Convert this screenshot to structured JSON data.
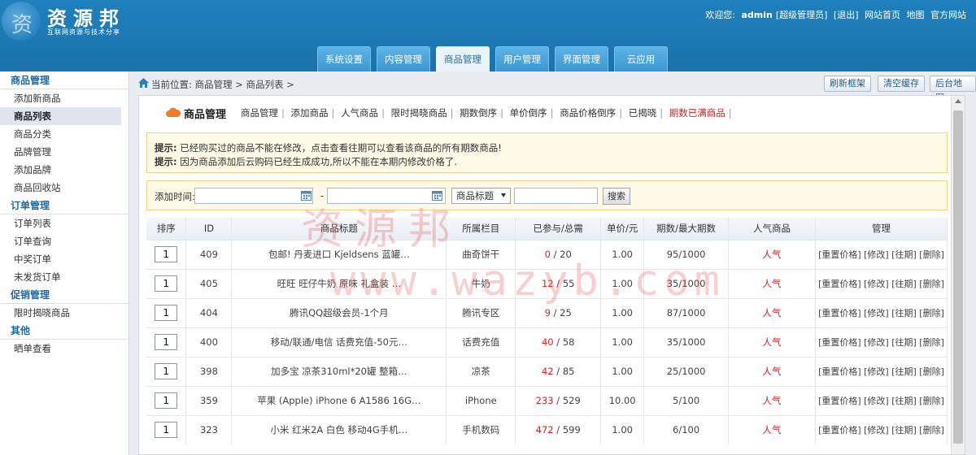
{
  "brand": {
    "logo_glyph": "资",
    "title": "资源邦",
    "subtitle": "互联网资源与技术分享"
  },
  "topbar": {
    "welcome": "欢迎您:",
    "username": "admin",
    "role": "[超级管理员]",
    "logout": "[退出]",
    "site_home": "网站首页",
    "map": "地图",
    "official": "官方网站"
  },
  "nav": {
    "tabs": [
      {
        "label": "系统设置"
      },
      {
        "label": "内容管理"
      },
      {
        "label": "商品管理",
        "active": true
      },
      {
        "label": "用户管理"
      },
      {
        "label": "界面管理"
      },
      {
        "label": "云应用"
      }
    ]
  },
  "sidebar": {
    "groups": [
      {
        "title": "商品管理",
        "items": [
          "添加新商品",
          "商品列表",
          "商品分类",
          "品牌管理",
          "添加品牌",
          "商品回收站"
        ]
      },
      {
        "title": "订单管理",
        "items": [
          "订单列表",
          "订单查询",
          "中奖订单",
          "未发货订单"
        ]
      },
      {
        "title": "促销管理",
        "items": [
          "限时揭晓商品"
        ]
      },
      {
        "title": "其他",
        "items": [
          "晒单查看"
        ]
      }
    ],
    "active_item": "商品列表"
  },
  "crumb": {
    "text": "当前位置: 商品管理 > 商品列表 >",
    "buttons": [
      "刷新框架",
      "清空缓存",
      "后台地图"
    ]
  },
  "module": {
    "title": "商品管理",
    "links": [
      "商品管理",
      "添加商品",
      "人气商品",
      "限时揭晓商品",
      "期数倒序",
      "单价倒序",
      "商品价格倒序",
      "已揭晓"
    ],
    "highlight_link": "期数已满商品"
  },
  "notice": {
    "label1": "提示:",
    "line1": "已经购买过的商品不能在修改，点击查看往期可以查看该商品的所有期数商品!",
    "label2": "提示:",
    "line2": "因为商品添加后云购码已经生成成功,所以不能在本期内修改价格了."
  },
  "filter": {
    "time_label": "添加时间:",
    "dash": "-",
    "select_value": "商品标题",
    "search_label": "搜索"
  },
  "table": {
    "headers": [
      "排序",
      "ID",
      "商品标题",
      "所属栏目",
      "已参与/总需",
      "单价/元",
      "期数/最大期数",
      "人气商品",
      "管理"
    ],
    "rows": [
      {
        "sort": "1",
        "id": "409",
        "title": "包邮! 丹麦进口 Kjeldsens 蓝罐…",
        "cat": "曲奇饼干",
        "done": "0",
        "total": "20",
        "price": "1.00",
        "period": "95/1000",
        "hot": "人气",
        "ops": "[重置价格] [修改] [往期] [删除]"
      },
      {
        "sort": "1",
        "id": "405",
        "title": "旺旺 旺仔牛奶 原味 礼盒装 …",
        "cat": "牛奶",
        "done": "12",
        "total": "55",
        "price": "1.00",
        "period": "35/1000",
        "hot": "人气",
        "ops": "[重置价格] [修改] [往期] [删除]"
      },
      {
        "sort": "1",
        "id": "404",
        "title": "腾讯QQ超级会员-1个月",
        "cat": "腾讯专区",
        "done": "9",
        "total": "25",
        "price": "1.00",
        "period": "87/1000",
        "hot": "人气",
        "ops": "[重置价格] [修改] [往期] [删除]"
      },
      {
        "sort": "1",
        "id": "400",
        "title": "移动/联通/电信 话费充值-50元…",
        "cat": "话费充值",
        "done": "40",
        "total": "58",
        "price": "1.00",
        "period": "35/1000",
        "hot": "人气",
        "ops": "[重置价格] [修改] [往期] [删除]"
      },
      {
        "sort": "1",
        "id": "398",
        "title": "加多宝 凉茶310ml*20罐 整箱…",
        "cat": "凉茶",
        "done": "42",
        "total": "85",
        "price": "1.00",
        "period": "25/1000",
        "hot": "人气",
        "ops": "[重置价格] [修改] [往期] [删除]"
      },
      {
        "sort": "1",
        "id": "359",
        "title": "苹果 (Apple) iPhone 6 A1586 16G…",
        "cat": "iPhone",
        "done": "233",
        "total": "529",
        "price": "10.00",
        "period": "5/100",
        "hot": "人气",
        "ops": "[重置价格] [修改] [往期] [删除]"
      },
      {
        "sort": "1",
        "id": "323",
        "title": "小米 红米2A 白色 移动4G手机…",
        "cat": "手机数码",
        "done": "472",
        "total": "599",
        "price": "1.00",
        "period": "6/100",
        "hot": "人气",
        "ops": "[重置价格] [修改] [往期] [删除]"
      }
    ]
  },
  "watermark": {
    "line1": "资源邦",
    "line2": "www.wazyb.com"
  },
  "colors": {
    "header_blue": "#1c77b2",
    "accent_red": "#e02020",
    "sidebar_group": "#1c6aa5"
  }
}
